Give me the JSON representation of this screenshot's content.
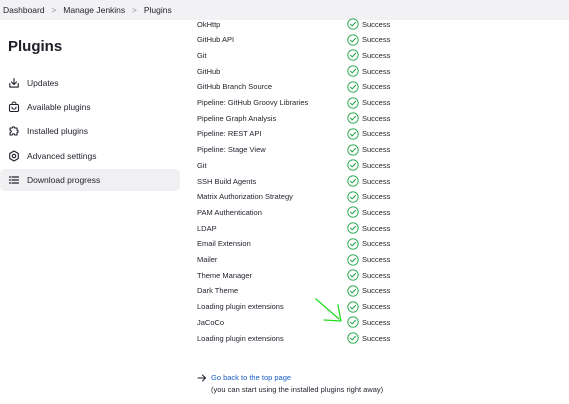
{
  "breadcrumb": {
    "items": [
      "Dashboard",
      "Manage Jenkins",
      "Plugins"
    ],
    "separator": ">"
  },
  "sidebar": {
    "title": "Plugins",
    "items": [
      {
        "label": "Updates",
        "icon": "download-icon"
      },
      {
        "label": "Available plugins",
        "icon": "shopping-bag-icon"
      },
      {
        "label": "Installed plugins",
        "icon": "puzzle-icon"
      },
      {
        "label": "Advanced settings",
        "icon": "gear-icon"
      },
      {
        "label": "Download progress",
        "icon": "list-icon",
        "active": true
      }
    ]
  },
  "progress": {
    "rows": [
      {
        "name": "OkHttp",
        "status": "Success"
      },
      {
        "name": "GitHub API",
        "status": "Success"
      },
      {
        "name": "Git",
        "status": "Success"
      },
      {
        "name": "GitHub",
        "status": "Success"
      },
      {
        "name": "GitHub Branch Source",
        "status": "Success"
      },
      {
        "name": "Pipeline: GitHub Groovy Libraries",
        "status": "Success"
      },
      {
        "name": "Pipeline Graph Analysis",
        "status": "Success"
      },
      {
        "name": "Pipeline: REST API",
        "status": "Success"
      },
      {
        "name": "Pipeline: Stage View",
        "status": "Success"
      },
      {
        "name": "Git",
        "status": "Success"
      },
      {
        "name": "SSH Build Agents",
        "status": "Success"
      },
      {
        "name": "Matrix Authorization Strategy",
        "status": "Success"
      },
      {
        "name": "PAM Authentication",
        "status": "Success"
      },
      {
        "name": "LDAP",
        "status": "Success"
      },
      {
        "name": "Email Extension",
        "status": "Success"
      },
      {
        "name": "Mailer",
        "status": "Success"
      },
      {
        "name": "Theme Manager",
        "status": "Success"
      },
      {
        "name": "Dark Theme",
        "status": "Success"
      },
      {
        "name": "Loading plugin extensions",
        "status": "Success"
      },
      {
        "name": "JaCoCo",
        "status": "Success"
      },
      {
        "name": "Loading plugin extensions",
        "status": "Success"
      }
    ]
  },
  "footer": {
    "back_link": "Go back to the top page",
    "back_note": "(you can start using the installed plugins right away)"
  },
  "colors": {
    "success_green": "#1ea446",
    "link_blue": "#1a5ec7",
    "annotation_arrow": "#22dd22"
  }
}
